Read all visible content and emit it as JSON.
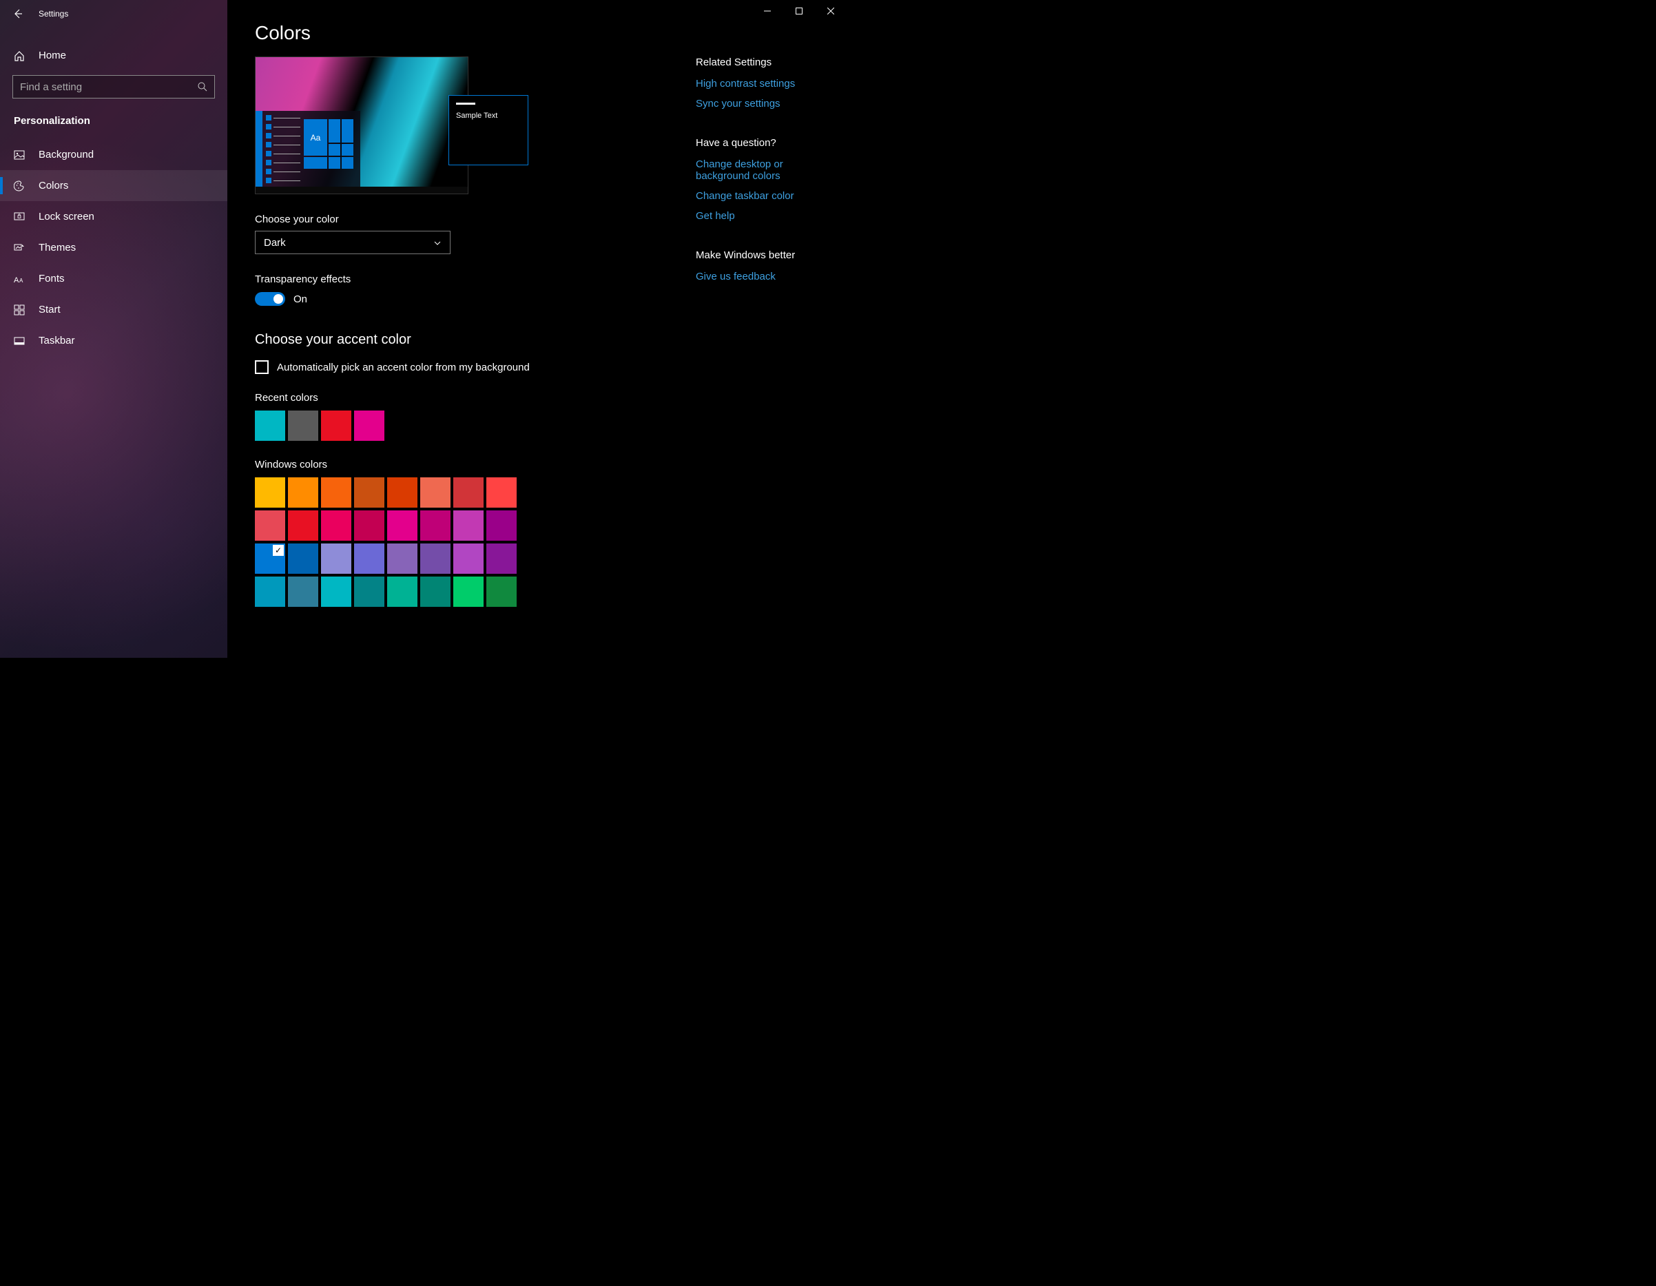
{
  "titlebar": {
    "app": "Settings"
  },
  "sidebar": {
    "home_label": "Home",
    "search_placeholder": "Find a setting",
    "section_title": "Personalization",
    "items": [
      {
        "label": "Background"
      },
      {
        "label": "Colors"
      },
      {
        "label": "Lock screen"
      },
      {
        "label": "Themes"
      },
      {
        "label": "Fonts"
      },
      {
        "label": "Start"
      },
      {
        "label": "Taskbar"
      }
    ]
  },
  "main": {
    "title": "Colors",
    "preview_sample_text": "Sample Text",
    "preview_tile_text": "Aa",
    "choose_color_label": "Choose your color",
    "choose_color_value": "Dark",
    "transparency_label": "Transparency effects",
    "transparency_value": "On",
    "accent_heading": "Choose your accent color",
    "auto_pick_label": "Automatically pick an accent color from my background",
    "recent_label": "Recent colors",
    "recent_colors": [
      "#00b7c3",
      "#5a5a5a",
      "#e81123",
      "#e3008c"
    ],
    "windows_label": "Windows colors",
    "windows_colors": [
      "#ffb900",
      "#ff8c00",
      "#f7630c",
      "#ca5010",
      "#da3b01",
      "#ef6950",
      "#d13438",
      "#ff4343",
      "#e74856",
      "#e81123",
      "#ea005e",
      "#c30052",
      "#e3008c",
      "#bf0077",
      "#c239b3",
      "#9a0089",
      "#0078d4",
      "#0063b1",
      "#8e8cd8",
      "#6b69d6",
      "#8764b8",
      "#744da9",
      "#b146c2",
      "#881798",
      "#0099bc",
      "#2d7d9a",
      "#00b7c3",
      "#038387",
      "#00b294",
      "#018574",
      "#00cc6a",
      "#10893e"
    ],
    "selected_color_index": 16
  },
  "right": {
    "related_h": "Related Settings",
    "related_links": [
      "High contrast settings",
      "Sync your settings"
    ],
    "question_h": "Have a question?",
    "question_links": [
      "Change desktop or background colors",
      "Change taskbar color",
      "Get help"
    ],
    "better_h": "Make Windows better",
    "better_links": [
      "Give us feedback"
    ]
  }
}
